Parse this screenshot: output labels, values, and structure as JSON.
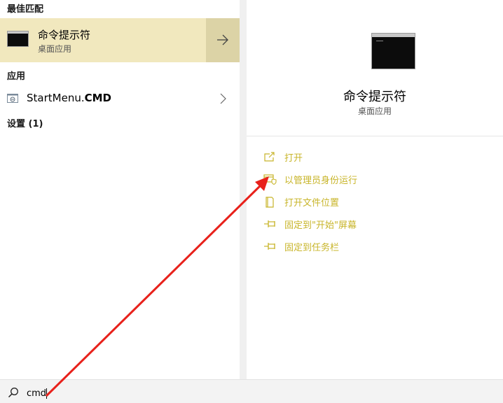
{
  "left_pane": {
    "best_match_header": "最佳匹配",
    "best_match": {
      "title": "命令提示符",
      "subtitle": "桌面应用",
      "icon": "command-prompt-icon",
      "arrow_icon": "arrow-right-icon"
    },
    "apps_header": "应用",
    "apps": [
      {
        "label_prefix": "StartMenu.",
        "label_bold": "CMD",
        "icon": "file-shortcut-icon",
        "chevron_icon": "chevron-right-icon"
      }
    ],
    "settings_header": "设置 (1)"
  },
  "right_pane": {
    "title": "命令提示符",
    "subtitle": "桌面应用",
    "icon": "command-prompt-icon",
    "actions": [
      {
        "label": "打开",
        "icon": "open-icon"
      },
      {
        "label": "以管理员身份运行",
        "icon": "run-as-admin-icon"
      },
      {
        "label": "打开文件位置",
        "icon": "open-file-location-icon"
      },
      {
        "label": "固定到\"开始\"屏幕",
        "icon": "pin-icon"
      },
      {
        "label": "固定到任务栏",
        "icon": "pin-icon"
      }
    ]
  },
  "search": {
    "value": "cmd",
    "icon": "search-icon"
  },
  "colors": {
    "accent_text": "#c8b52a",
    "highlight_bg": "#f1e8be",
    "highlight_arrow_bg": "#dcd3a6",
    "annotation_arrow": "#e8211b"
  }
}
